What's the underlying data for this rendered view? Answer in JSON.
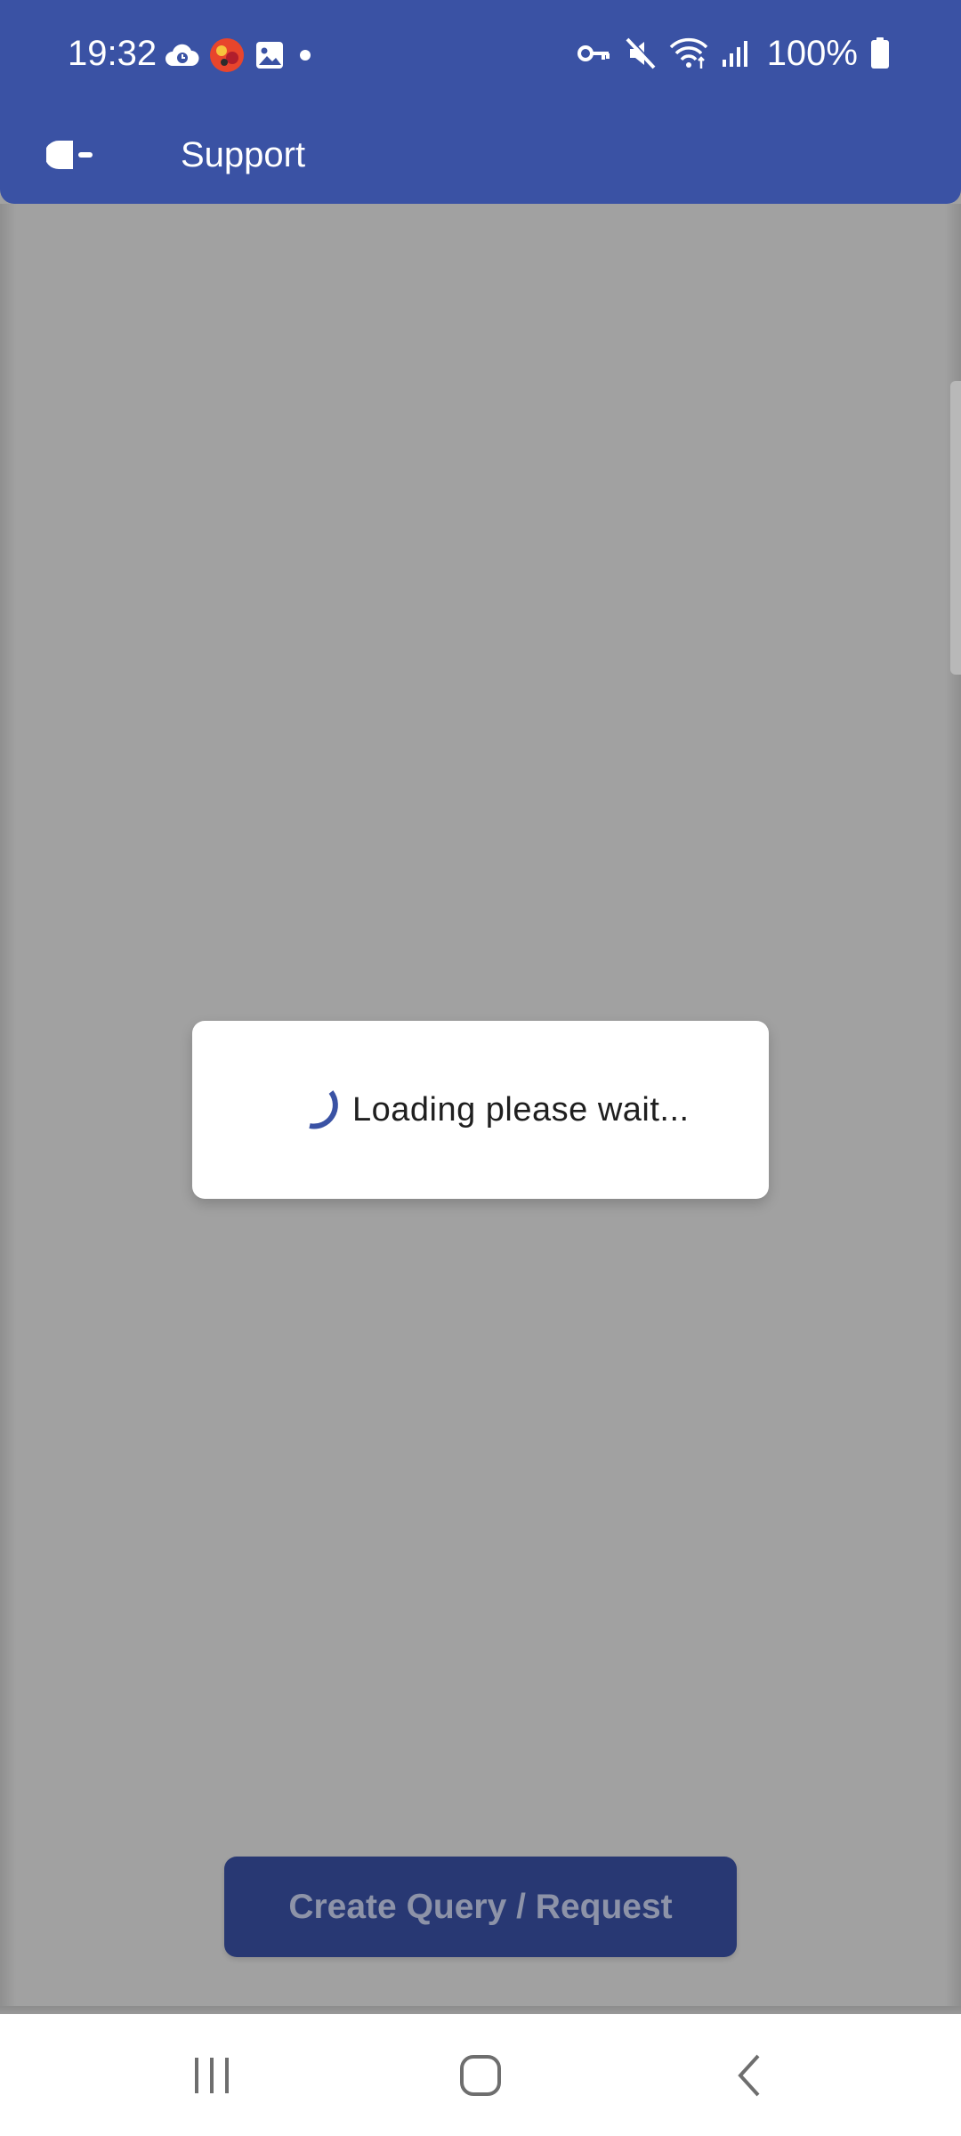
{
  "status_bar": {
    "time": "19:32",
    "battery_percent": "100%",
    "left_icons": [
      "cloud-icon",
      "app-notification-icon",
      "image-icon",
      "dot-icon"
    ],
    "right_icons": [
      "vpn-key-icon",
      "mute-icon",
      "wifi-icon",
      "signal-icon",
      "battery-icon"
    ]
  },
  "toolbar": {
    "title": "Support",
    "back_icon": "back-arrow-icon"
  },
  "dialog": {
    "message": "Loading please wait...",
    "spinner_color": "#3a52a4"
  },
  "actions": {
    "create_label": "Create Query / Request"
  },
  "nav": {
    "recents_icon": "recents-icon",
    "home_icon": "home-icon",
    "back_icon": "back-icon"
  },
  "colors": {
    "primary": "#3a52a4",
    "overlay": "#a1a1a1",
    "button_dimmed": "#283873"
  }
}
